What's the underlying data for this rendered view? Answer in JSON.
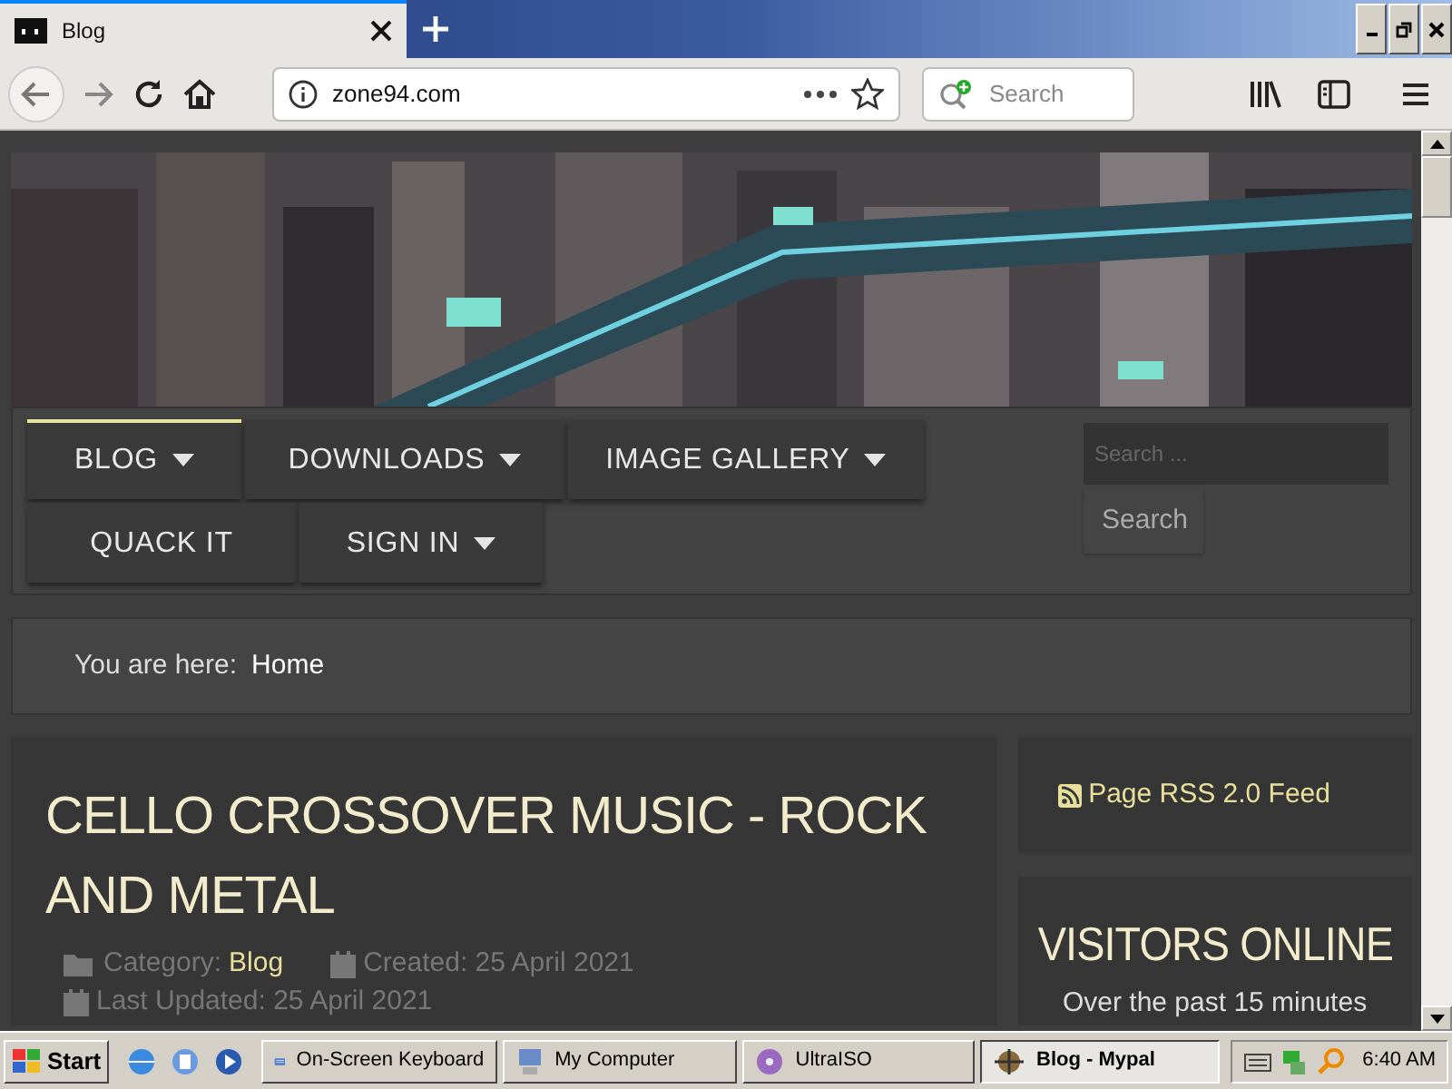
{
  "browser": {
    "tabs": [
      {
        "title": "Blog",
        "selected": true
      }
    ],
    "url": "zone94.com",
    "search": {
      "placeholder": "Search"
    }
  },
  "site": {
    "nav": [
      {
        "label": "BLOG",
        "dropdown": true,
        "selected": true
      },
      {
        "label": "DOWNLOADS",
        "dropdown": true,
        "selected": false
      },
      {
        "label": "IMAGE GALLERY",
        "dropdown": true,
        "selected": false
      },
      {
        "label": "QUACK IT",
        "dropdown": false,
        "selected": false
      },
      {
        "label": "SIGN IN",
        "dropdown": true,
        "selected": false
      }
    ],
    "search": {
      "placeholder": "Search ...",
      "button": "Search"
    },
    "breadcrumb": {
      "label": "You are here:",
      "current": "Home"
    },
    "article": {
      "title": "CELLO CROSSOVER MUSIC - ROCK AND METAL",
      "category_label": "Category:",
      "category": "Blog",
      "created": "Created: 25 April 2021",
      "updated": "Last Updated: 25 April 2021"
    },
    "rss": "Page RSS 2.0 Feed",
    "visitors": {
      "title": "VISITORS ONLINE",
      "text": "Over the past 15 minutes"
    }
  },
  "taskbar": {
    "start": "Start",
    "tasks": [
      {
        "label": "On-Screen Keyboard",
        "kind": "keyboard",
        "selected": false
      },
      {
        "label": "My Computer",
        "kind": "computer",
        "selected": false
      },
      {
        "label": "UltraISO",
        "kind": "disc",
        "selected": false
      },
      {
        "label": "Blog - Mypal",
        "kind": "browser",
        "selected": true
      }
    ],
    "clock": "6:40 AM"
  }
}
